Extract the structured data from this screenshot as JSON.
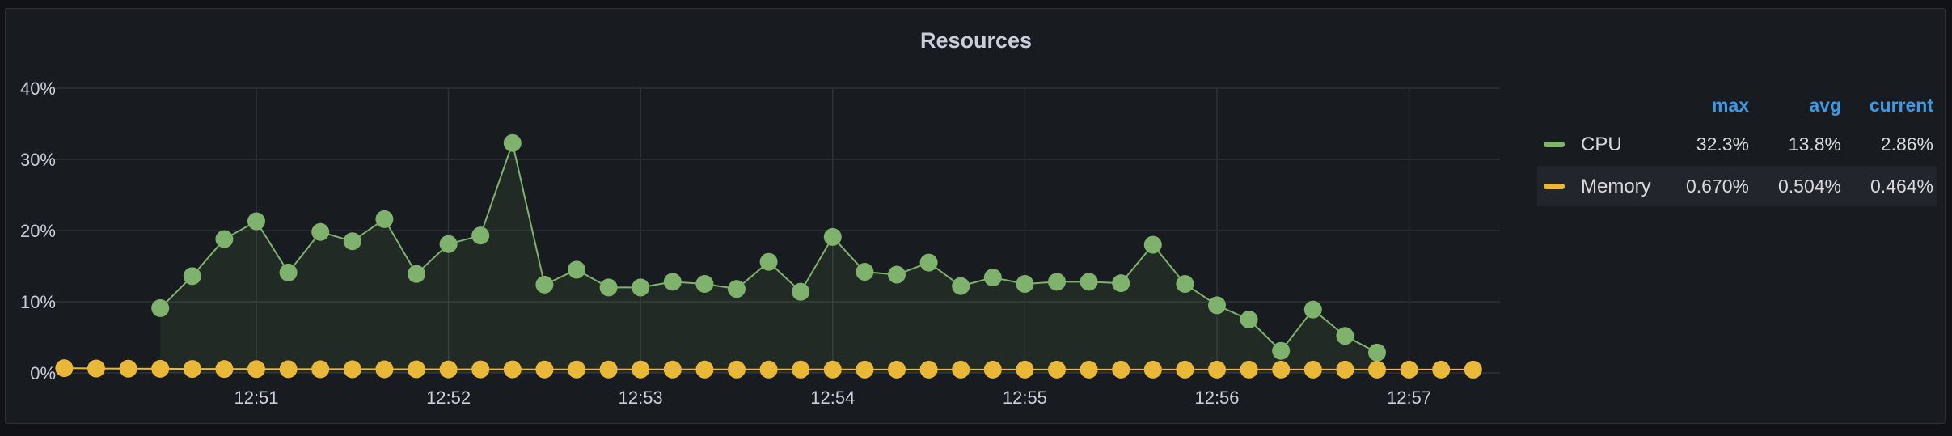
{
  "panel_title": "Resources",
  "legend": {
    "headers": {
      "max": "max",
      "avg": "avg",
      "current": "current"
    },
    "rows": [
      {
        "name": "CPU",
        "color": "#7eb26d",
        "max": "32.3%",
        "avg": "13.8%",
        "current": "2.86%"
      },
      {
        "name": "Memory",
        "color": "#eab839",
        "max": "0.670%",
        "avg": "0.504%",
        "current": "0.464%"
      }
    ]
  },
  "chart_data": {
    "type": "line",
    "title": "Resources",
    "xlabel": "",
    "ylabel": "",
    "x_tick_labels": [
      "12:51",
      "12:52",
      "12:53",
      "12:54",
      "12:55",
      "12:56",
      "12:57"
    ],
    "y_tick_labels": [
      "0%",
      "10%",
      "20%",
      "30%",
      "40%"
    ],
    "ylim": [
      0,
      40
    ],
    "grid": true,
    "legend_position": "right",
    "sample_interval_seconds": 10,
    "series": [
      {
        "name": "CPU",
        "color": "#7eb26d",
        "fill": true,
        "start_time": "12:50:30",
        "values": [
          9.1,
          13.6,
          18.8,
          21.3,
          14.1,
          19.8,
          18.5,
          21.6,
          13.9,
          18.1,
          19.3,
          32.3,
          12.4,
          14.5,
          12.0,
          12.0,
          12.8,
          12.5,
          11.8,
          15.6,
          11.4,
          19.1,
          14.2,
          13.8,
          15.5,
          12.2,
          13.4,
          12.5,
          12.8,
          12.8,
          12.6,
          18.0,
          12.5,
          9.5,
          7.5,
          3.1,
          8.9,
          5.2,
          2.86
        ]
      },
      {
        "name": "Memory",
        "color": "#eab839",
        "fill": false,
        "start_time": "12:50:00",
        "values": [
          0.67,
          0.62,
          0.6,
          0.58,
          0.56,
          0.55,
          0.54,
          0.53,
          0.52,
          0.52,
          0.51,
          0.51,
          0.5,
          0.5,
          0.5,
          0.49,
          0.49,
          0.49,
          0.49,
          0.48,
          0.48,
          0.48,
          0.48,
          0.48,
          0.48,
          0.47,
          0.47,
          0.47,
          0.47,
          0.47,
          0.47,
          0.47,
          0.47,
          0.47,
          0.47,
          0.47,
          0.47,
          0.47,
          0.47,
          0.47,
          0.47,
          0.47,
          0.47,
          0.47,
          0.464
        ]
      }
    ]
  }
}
